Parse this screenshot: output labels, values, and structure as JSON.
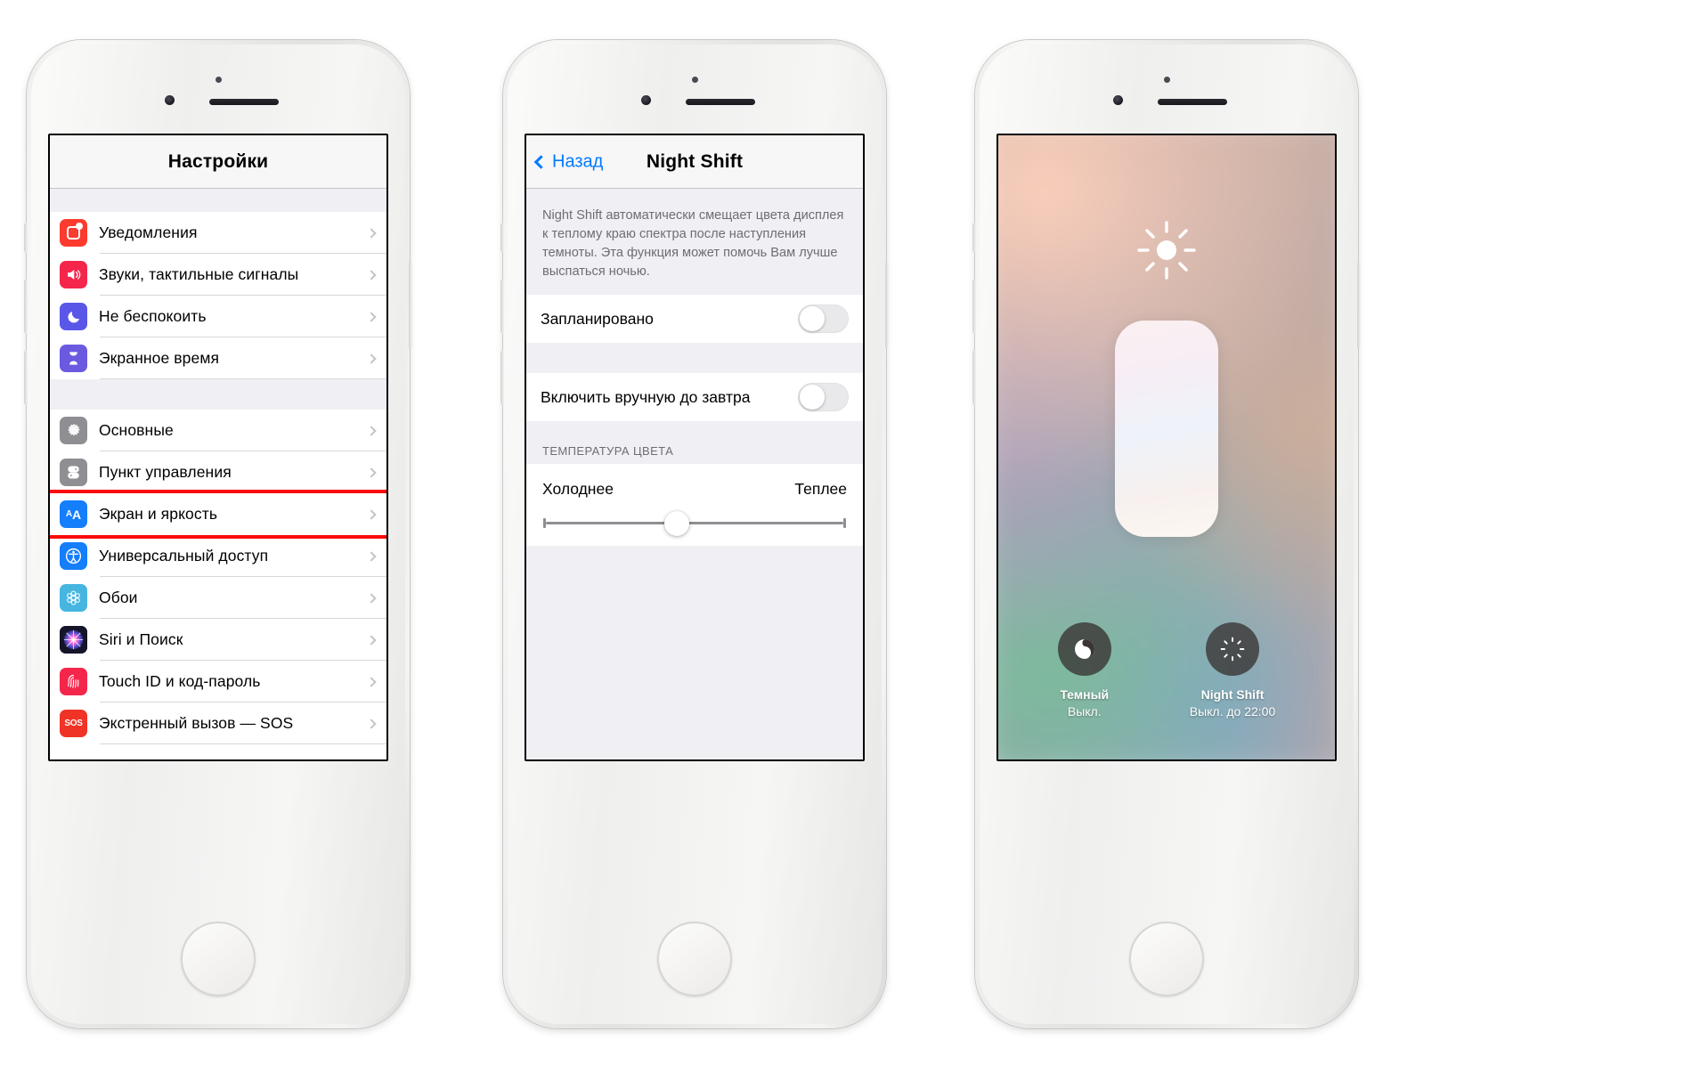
{
  "phone1": {
    "nav_title": "Настройки",
    "groups": [
      {
        "rows": [
          {
            "label": "Уведомления",
            "icon": "notifications-icon",
            "icon_class": "ic-notif"
          },
          {
            "label": "Звуки, тактильные сигналы",
            "icon": "sounds-icon",
            "icon_class": "ic-sound"
          },
          {
            "label": "Не беспокоить",
            "icon": "do-not-disturb-icon",
            "icon_class": "ic-dnd"
          },
          {
            "label": "Экранное время",
            "icon": "screen-time-icon",
            "icon_class": "ic-screen-time"
          }
        ]
      },
      {
        "rows": [
          {
            "label": "Основные",
            "icon": "gear-icon",
            "icon_class": "ic-general"
          },
          {
            "label": "Пункт управления",
            "icon": "control-center-icon",
            "icon_class": "ic-control"
          },
          {
            "label": "Экран и яркость",
            "icon": "display-brightness-icon",
            "icon_class": "ic-display",
            "highlighted": true
          },
          {
            "label": "Универсальный доступ",
            "icon": "accessibility-icon",
            "icon_class": "ic-access"
          },
          {
            "label": "Обои",
            "icon": "wallpaper-icon",
            "icon_class": "ic-wall"
          },
          {
            "label": "Siri и Поиск",
            "icon": "siri-icon",
            "icon_class": "ic-siri"
          },
          {
            "label": "Touch ID и код-пароль",
            "icon": "touch-id-icon",
            "icon_class": "ic-touch"
          },
          {
            "label": "Экстренный вызов — SOS",
            "icon": "sos-icon",
            "icon_class": "ic-sos"
          }
        ]
      }
    ],
    "highlight_color": "#fa0a0a"
  },
  "phone2": {
    "back_label": "Назад",
    "nav_title": "Night Shift",
    "description": "Night Shift автоматически смещает цвета дисплея к теплому краю спектра после наступления темноты. Эта функция может помочь Вам лучше выспаться ночью.",
    "rows": [
      {
        "label": "Запланировано",
        "toggle": "off"
      },
      {
        "label": "Включить вручную до завтра",
        "toggle": "off"
      }
    ],
    "section_header": "ТЕМПЕРАТУРА ЦВЕТА",
    "slider": {
      "left_label": "Холоднее",
      "right_label": "Теплее",
      "value_percent": 44
    }
  },
  "phone3": {
    "brightness_icon": "sun-brightness-icon",
    "buttons": [
      {
        "name": "Темный",
        "state": "Выкл.",
        "icon": "dark-mode-icon"
      },
      {
        "name": "Night Shift",
        "state": "Выкл. до 22:00",
        "icon": "night-shift-icon"
      }
    ]
  }
}
